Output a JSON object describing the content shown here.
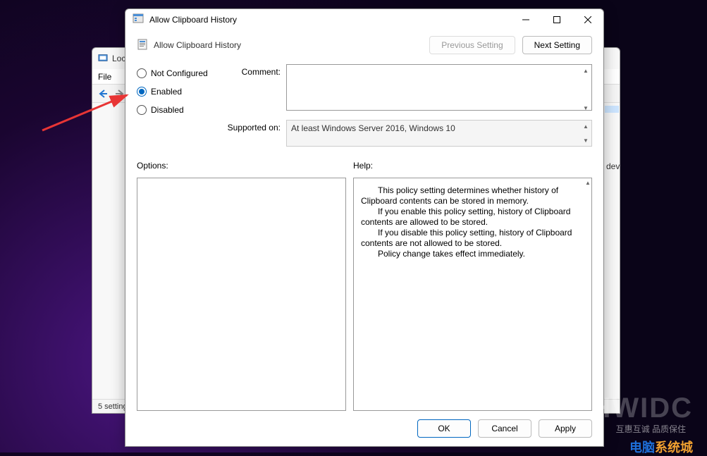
{
  "back_window": {
    "title_prefix": "Loc",
    "menu_file": "File",
    "status_text": "5 setting"
  },
  "dialog": {
    "title": "Allow Clipboard History",
    "policy_name": "Allow Clipboard History",
    "nav_prev": "Previous Setting",
    "nav_next": "Next Setting",
    "radio_not_configured": "Not Configured",
    "radio_enabled": "Enabled",
    "radio_disabled": "Disabled",
    "selected_radio": "enabled",
    "comment_label": "Comment:",
    "comment_value": "",
    "supported_label": "Supported on:",
    "supported_value": "At least Windows Server 2016, Windows 10",
    "options_label": "Options:",
    "help_label": "Help:",
    "help_p1": "This policy setting determines whether history of Clipboard contents can be stored in memory.",
    "help_p2": "If you enable this policy setting, history of Clipboard contents are allowed to be stored.",
    "help_p3": "If you disable this policy setting, history of Clipboard contents are not allowed to be stored.",
    "help_p4": "Policy change takes effect immediately.",
    "btn_ok": "OK",
    "btn_cancel": "Cancel",
    "btn_apply": "Apply"
  },
  "side_text": "dev",
  "watermark": {
    "big": "HWIDC",
    "tagline": "互惠互诚  品质保住",
    "brand_a": "电脑",
    "brand_b": "系统城"
  }
}
